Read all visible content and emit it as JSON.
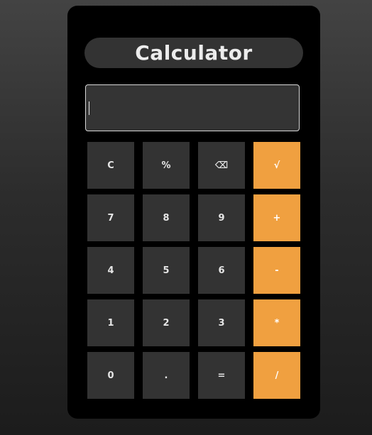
{
  "app": {
    "title": "Calculator"
  },
  "display": {
    "value": ""
  },
  "keys": [
    {
      "label": "C",
      "name": "clear-button",
      "type": "function"
    },
    {
      "label": "%",
      "name": "percent-button",
      "type": "function"
    },
    {
      "label": "⌫",
      "name": "backspace-button",
      "type": "function"
    },
    {
      "label": "√",
      "name": "sqrt-button",
      "type": "operator"
    },
    {
      "label": "7",
      "name": "digit-7-button",
      "type": "digit"
    },
    {
      "label": "8",
      "name": "digit-8-button",
      "type": "digit"
    },
    {
      "label": "9",
      "name": "digit-9-button",
      "type": "digit"
    },
    {
      "label": "+",
      "name": "add-button",
      "type": "operator"
    },
    {
      "label": "4",
      "name": "digit-4-button",
      "type": "digit"
    },
    {
      "label": "5",
      "name": "digit-5-button",
      "type": "digit"
    },
    {
      "label": "6",
      "name": "digit-6-button",
      "type": "digit"
    },
    {
      "label": "-",
      "name": "subtract-button",
      "type": "operator"
    },
    {
      "label": "1",
      "name": "digit-1-button",
      "type": "digit"
    },
    {
      "label": "2",
      "name": "digit-2-button",
      "type": "digit"
    },
    {
      "label": "3",
      "name": "digit-3-button",
      "type": "digit"
    },
    {
      "label": "*",
      "name": "multiply-button",
      "type": "operator"
    },
    {
      "label": "0",
      "name": "digit-0-button",
      "type": "digit"
    },
    {
      "label": ".",
      "name": "decimal-button",
      "type": "digit"
    },
    {
      "label": "=",
      "name": "equals-button",
      "type": "function"
    },
    {
      "label": "/",
      "name": "divide-button",
      "type": "operator"
    }
  ],
  "colors": {
    "operator_accent": "#f0a040",
    "key_background": "#333333",
    "panel_background": "#000000"
  }
}
